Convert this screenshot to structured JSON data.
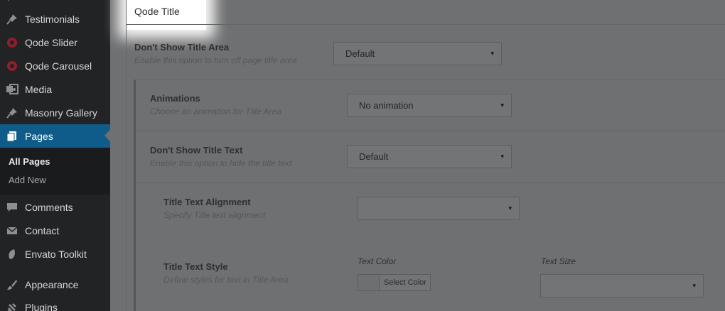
{
  "sidebar": {
    "items": [
      {
        "label": "Testimonials",
        "icon": "pin-icon"
      },
      {
        "label": "Qode Slider",
        "icon": "slider-icon"
      },
      {
        "label": "Qode Carousel",
        "icon": "carousel-icon"
      },
      {
        "label": "Media",
        "icon": "media-icon"
      },
      {
        "label": "Masonry Gallery",
        "icon": "pin-icon"
      },
      {
        "label": "Pages",
        "icon": "pages-icon"
      },
      {
        "label": "Comments",
        "icon": "comment-icon"
      },
      {
        "label": "Contact",
        "icon": "mail-icon"
      },
      {
        "label": "Envato Toolkit",
        "icon": "leaf-icon"
      },
      {
        "label": "Appearance",
        "icon": "brush-icon"
      },
      {
        "label": "Plugins",
        "icon": "plug-icon"
      }
    ],
    "submenu": {
      "all_pages": "All Pages",
      "add_new": "Add New"
    },
    "colors": {
      "active_bg": "#0f5c8a",
      "sidebar_bg": "#222325"
    }
  },
  "box": {
    "title": "Qode Title"
  },
  "fields": {
    "show_title_area": {
      "label": "Don't Show Title Area",
      "description": "Enable this option to turn off page title area",
      "value": "Default"
    },
    "animations": {
      "label": "Animations",
      "description": "Choose an animation for Title Area",
      "value": "No animation"
    },
    "show_title_text": {
      "label": "Don't Show Title Text",
      "description": "Enable this option to hide the title text",
      "value": "Default"
    },
    "title_text_alignment": {
      "label": "Title Text Alignment",
      "description": "Specify Title text alignment",
      "value": ""
    },
    "title_text_style": {
      "label": "Title Text Style",
      "description": "Define styles for text in Title Area",
      "text_color_label": "Text Color",
      "select_color_button": "Select Color",
      "text_size_label": "Text Size",
      "text_size_value": ""
    }
  },
  "caret": "▾"
}
